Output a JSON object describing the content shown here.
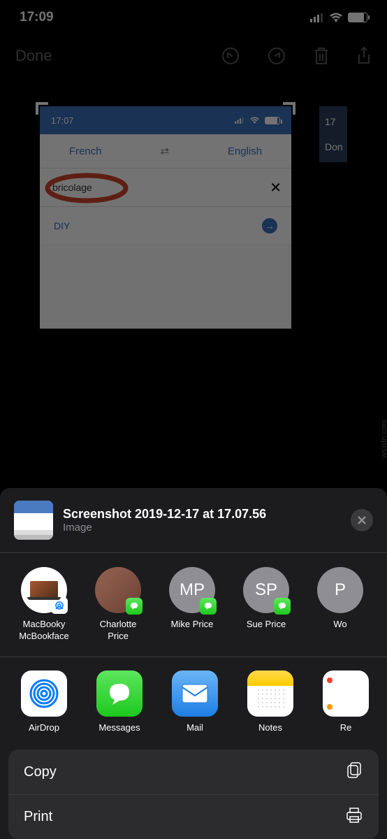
{
  "status_bar": {
    "time": "17:09"
  },
  "editor": {
    "done": "Done"
  },
  "screenshot_content": {
    "time": "17:07",
    "lang_from": "French",
    "lang_to": "English",
    "word": "bricolage",
    "translation": "DIY"
  },
  "second_card": {
    "time": "17",
    "done": "Don"
  },
  "share": {
    "title": "Screenshot 2019-12-17 at 17.07.56",
    "subtitle": "Image"
  },
  "contacts": [
    {
      "name": "MacBooky McBookface",
      "type": "airdrop"
    },
    {
      "name": "Charlotte Price",
      "type": "photo"
    },
    {
      "name": "Mike Price",
      "type": "initials",
      "initials": "MP"
    },
    {
      "name": "Sue Price",
      "type": "initials",
      "initials": "SP"
    },
    {
      "name": "Wo",
      "type": "initials",
      "initials": "P"
    }
  ],
  "apps": [
    {
      "name": "AirDrop"
    },
    {
      "name": "Messages"
    },
    {
      "name": "Mail"
    },
    {
      "name": "Notes"
    },
    {
      "name": "Re"
    }
  ],
  "actions": {
    "copy": "Copy",
    "print": "Print"
  },
  "watermark": "wsxdn.com"
}
